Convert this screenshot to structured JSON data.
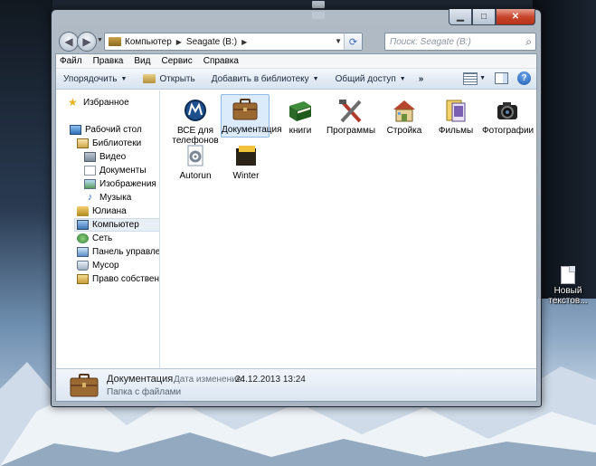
{
  "colors": {
    "accent": "#3a6db0",
    "close_button": "#c8462c",
    "selection": "#dcebfc"
  },
  "window": {
    "min_label": "▁",
    "max_label": "□",
    "close_label": "✕"
  },
  "address": {
    "crumbs": [
      "Компьютер",
      "Seagate (B:)"
    ],
    "search_placeholder": "Поиск: Seagate (B:)"
  },
  "menu": [
    "Файл",
    "Правка",
    "Вид",
    "Сервис",
    "Справка"
  ],
  "toolbar": {
    "organize": "Упорядочить",
    "open": "Открыть",
    "add_to_library": "Добавить в библиотеку",
    "share": "Общий доступ",
    "more": "»"
  },
  "nav": {
    "favorites": "Избранное",
    "desktop": "Рабочий стол",
    "libraries": "Библиотеки",
    "video": "Видео",
    "documents": "Документы",
    "images": "Изображения",
    "music": "Музыка",
    "user": "Юлиана",
    "computer": "Компьютер",
    "network": "Сеть",
    "control_panel": "Панель управления",
    "trash": "Мусор",
    "property": "Право собственности"
  },
  "files": [
    {
      "name": "ВСЕ для телефонов",
      "icon": "motorola-icon"
    },
    {
      "name": "Документация",
      "icon": "briefcase-icon"
    },
    {
      "name": "книги",
      "icon": "book-icon"
    },
    {
      "name": "Программы",
      "icon": "tools-icon"
    },
    {
      "name": "Стройка",
      "icon": "house-icon"
    },
    {
      "name": "Фильмы",
      "icon": "film-icon"
    },
    {
      "name": "Фотографии",
      "icon": "camera-icon"
    },
    {
      "name": "Autorun",
      "icon": "autorun-icon"
    },
    {
      "name": "Winter",
      "icon": "folder-icon"
    }
  ],
  "details": {
    "name": "Документация",
    "type": "Папка с файлами",
    "date_label": "Дата изменения:",
    "date_value": "24.12.2013 13:24"
  },
  "desktop": {
    "file_label": "Новый текстов..."
  }
}
